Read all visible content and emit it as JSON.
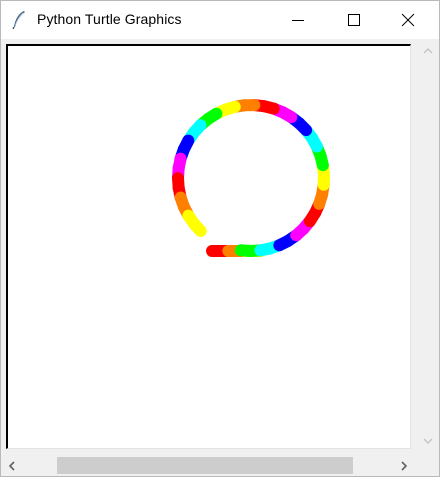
{
  "window": {
    "title": "Python Turtle Graphics",
    "icon": "feather-icon",
    "controls": [
      "minimize-icon",
      "maximize-icon",
      "close-icon"
    ]
  },
  "scrollbars": {
    "vertical_arrows": [
      "chevron-up-icon",
      "chevron-down-icon"
    ],
    "horizontal_arrows": [
      "chevron-left-icon",
      "chevron-right-icon"
    ],
    "horizontal_thumb_position": 0.18,
    "horizontal_thumb_fraction": 0.78
  },
  "drawing": {
    "background": "#ffffff",
    "path_colors_cycle": [
      "#ff0000",
      "#ff8000",
      "#ffff00",
      "#00ff00",
      "#00ffff",
      "#0000ff",
      "#ff00ff"
    ],
    "line_cap": "round"
  }
}
